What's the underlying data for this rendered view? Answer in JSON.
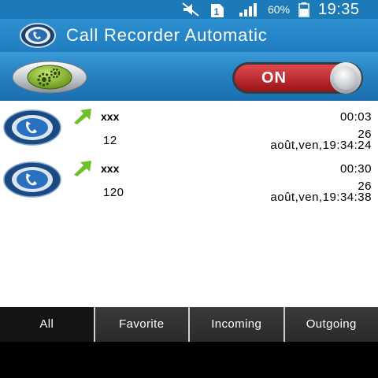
{
  "status_bar": {
    "battery_percent": "60%",
    "time": "19:35",
    "icons": [
      "mute-icon",
      "sim-icon",
      "signal-icon",
      "battery-icon"
    ]
  },
  "app": {
    "title": "Call Recorder Automatic",
    "icon": "phone-recorder-icon"
  },
  "controls": {
    "settings_icon": "gears-icon",
    "toggle_label": "ON",
    "toggle_on": true
  },
  "calls": [
    {
      "name": "xxx",
      "size": "12",
      "duration": "00:03",
      "day": "26",
      "stamp": "août,ven,19:34:24",
      "direction": "outgoing-arrow-icon"
    },
    {
      "name": "xxx",
      "size": "120",
      "duration": "00:30",
      "day": "26",
      "stamp": "août,ven,19:34:38",
      "direction": "outgoing-arrow-icon"
    }
  ],
  "tabs": [
    {
      "label": "All",
      "active": true
    },
    {
      "label": "Favorite",
      "active": false
    },
    {
      "label": "Incoming",
      "active": false
    },
    {
      "label": "Outgoing",
      "active": false
    }
  ],
  "colors": {
    "primary": "#1f7dc0",
    "toggle_red": "#c0262b",
    "arrow_green": "#6cc12a",
    "settings_green": "#7db020"
  }
}
